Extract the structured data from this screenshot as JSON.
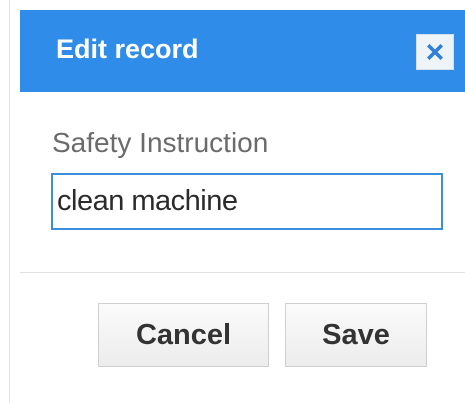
{
  "dialog": {
    "title": "Edit record",
    "close_icon": "close-x-icon",
    "colors": {
      "titlebar": "#2f8ce9",
      "input_border": "#3c8fdc"
    }
  },
  "form": {
    "field_label": "Safety Instruction",
    "field_value": "clean machine"
  },
  "buttons": {
    "cancel_label": "Cancel",
    "save_label": "Save"
  }
}
